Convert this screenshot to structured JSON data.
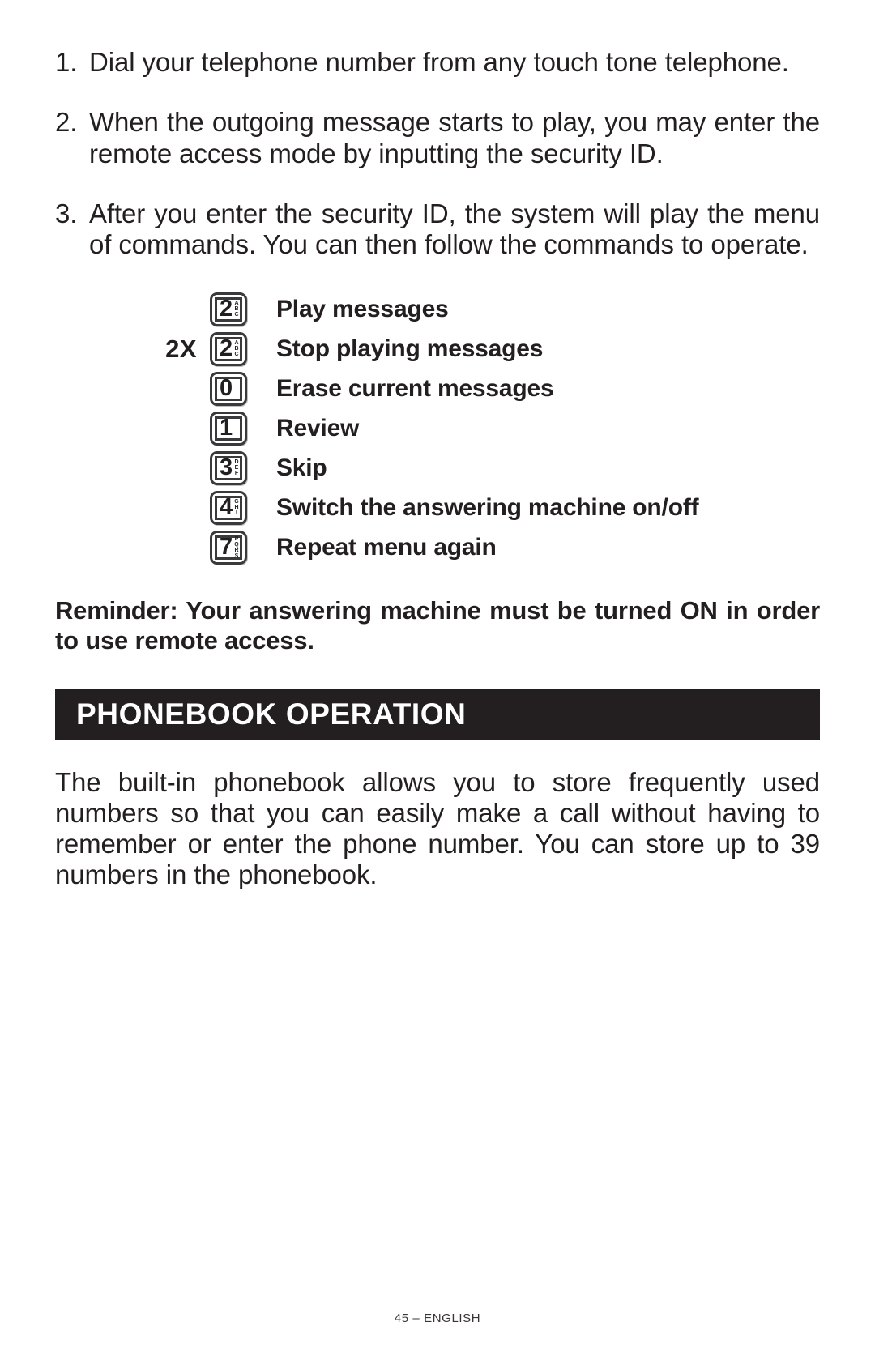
{
  "steps": [
    {
      "num": "1.",
      "text": "Dial your telephone number from any touch tone telephone."
    },
    {
      "num": "2.",
      "text": "When the outgoing message starts to play, you may enter the remote access mode by inputting the security ID."
    },
    {
      "num": "3.",
      "text": "After you enter the security ID, the system will play the menu of commands. You can then follow the commands to operate."
    }
  ],
  "commands": [
    {
      "prefix": "",
      "digit": "2",
      "letters": "ABC",
      "label": "Play messages"
    },
    {
      "prefix": "2X",
      "digit": "2",
      "letters": "ABC",
      "label": "Stop playing messages"
    },
    {
      "prefix": "",
      "digit": "0",
      "letters": "",
      "label": "Erase current messages"
    },
    {
      "prefix": "",
      "digit": "1",
      "letters": "",
      "label": "Review"
    },
    {
      "prefix": "",
      "digit": "3",
      "letters": "DEF",
      "label": "Skip"
    },
    {
      "prefix": "",
      "digit": "4",
      "letters": "GHI",
      "label": "Switch the answering machine on/off"
    },
    {
      "prefix": "",
      "digit": "7",
      "letters": "PQRS",
      "label": "Repeat menu again"
    }
  ],
  "reminder": "Reminder:  Your answering machine must be turned ON in order to use remote access.",
  "section": {
    "title": "PHONEBOOK OPERATION",
    "banner_color": "#231f20",
    "banner_text_color": "#ffffff"
  },
  "body_paragraph": "The built-in phonebook allows you to store frequently used numbers so that you can easily make a call without having to remember or enter the phone number. You can store up to 39 numbers in the phonebook.",
  "footer": "45 – ENGLISH"
}
